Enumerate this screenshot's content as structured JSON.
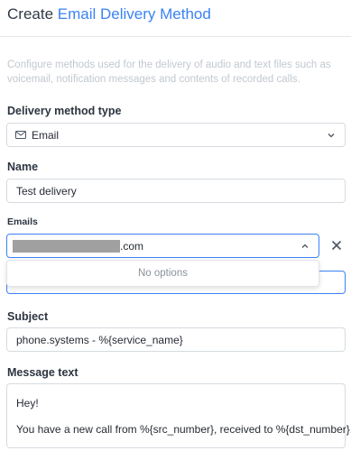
{
  "header": {
    "title_prefix": "Create",
    "title_highlight": "Email Delivery Method"
  },
  "description": "Configure methods used for the delivery of audio and text files such as voicemail, notification messages and contents of recorded calls.",
  "delivery_type": {
    "label": "Delivery method type",
    "value": "Email",
    "icon": "envelope-icon"
  },
  "name": {
    "label": "Name",
    "value": "Test delivery"
  },
  "emails": {
    "label": "Emails",
    "value_suffix": ".com",
    "dropdown_text": "No options"
  },
  "subject": {
    "label": "Subject",
    "value": "phone.systems - %{service_name}"
  },
  "message": {
    "label": "Message text",
    "line1": "Hey!",
    "line2": "You have a new call from %{src_number}, received to %{dst_number}."
  },
  "colors": {
    "accent": "#3b82f6",
    "border": "#d5dbe1",
    "muted_text": "#c2c8cf"
  }
}
